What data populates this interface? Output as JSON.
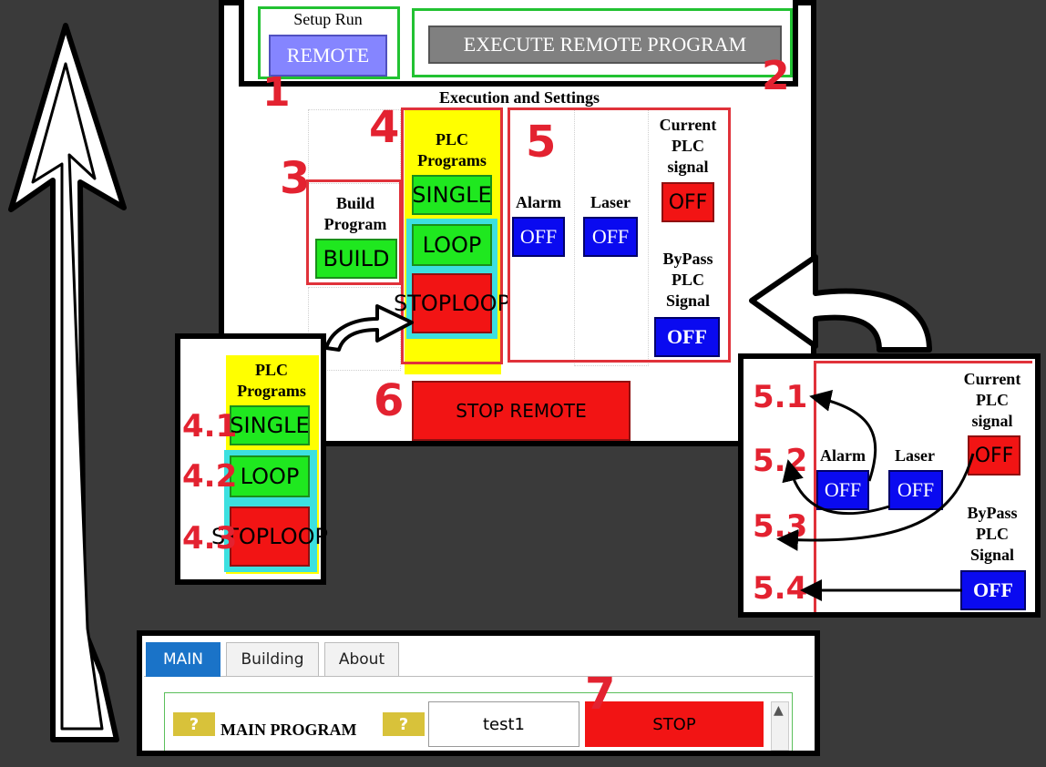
{
  "setup": {
    "label": "Setup Run",
    "remote_button": "REMOTE",
    "execute_button": "EXECUTE REMOTE PROGRAM"
  },
  "callouts": {
    "n1": "1",
    "n2": "2",
    "n3": "3",
    "n4": "4",
    "n5": "5",
    "n6": "6",
    "n7": "7",
    "n41": "4.1",
    "n42": "4.2",
    "n43": "4.3",
    "n51": "5.1",
    "n52": "5.2",
    "n53": "5.3",
    "n54": "5.4"
  },
  "execution": {
    "title": "Execution and Settings"
  },
  "build": {
    "label_line1": "Build",
    "label_line2": "Program",
    "button": "BUILD"
  },
  "plc": {
    "label_line1": "PLC",
    "label_line2": "Programs",
    "single": "SINGLE",
    "loop": "LOOP",
    "stop_loop_line1": "STOP",
    "stop_loop_line2": "LOOP"
  },
  "signals": {
    "alarm_label": "Alarm",
    "alarm_value": "OFF",
    "laser_label": "Laser",
    "laser_value": "OFF",
    "current_line1": "Current",
    "current_line2": "PLC",
    "current_line3": "signal",
    "current_value": "OFF",
    "bypass_line1": "ByPass",
    "bypass_line2": "PLC",
    "bypass_line3": "Signal",
    "bypass_value": "OFF"
  },
  "stop_remote": "STOP REMOTE",
  "bottom": {
    "tabs": [
      {
        "label": "MAIN",
        "active": true
      },
      {
        "label": "Building"
      },
      {
        "label": "About"
      }
    ],
    "main_program_label": "MAIN PROGRAM",
    "program_value": "test1",
    "stop_button": "STOP"
  },
  "colors": {
    "background": "#3a3a3a",
    "callout": "#e32230",
    "highlight_yellow": "#ffff00",
    "green_button": "#1fe81f",
    "red_button": "#f21414",
    "blue_button": "#0a0af0",
    "tab_active": "#1a73c8"
  }
}
